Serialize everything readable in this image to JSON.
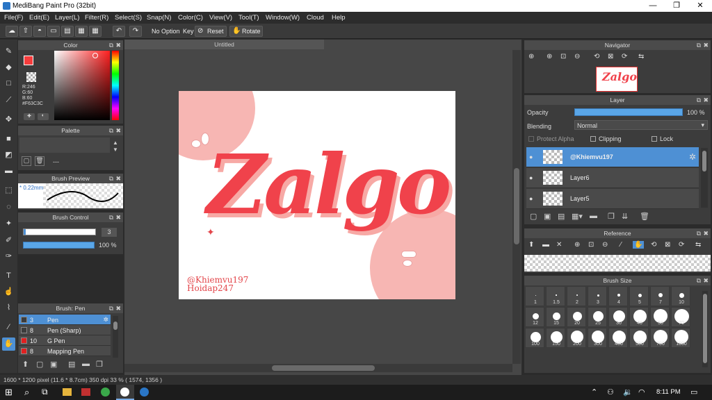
{
  "window": {
    "title": "MediBang Paint Pro (32bit)",
    "minimize": "—",
    "maximize": "❐",
    "close": "✕"
  },
  "menu": [
    "File(F)",
    "Edit(E)",
    "Layer(L)",
    "Filter(R)",
    "Select(S)",
    "Snap(N)",
    "Color(C)",
    "View(V)",
    "Tool(T)",
    "Window(W)",
    "Cloud",
    "Help"
  ],
  "toolbar": {
    "no_option": "No Option",
    "key": "Key",
    "reset": "Reset",
    "rotate": "Rotate"
  },
  "color_panel": {
    "title": "Color",
    "r": "R:246",
    "g": "G:60",
    "b": "B:60",
    "hex": "#F63C3C",
    "primary": "#f63c3c"
  },
  "palette_panel": {
    "title": "Palette",
    "dash": "---"
  },
  "brush_preview": {
    "title": "Brush Preview",
    "size": "* 0.22mm"
  },
  "brush_control": {
    "title": "Brush Control",
    "size": "3",
    "opacity": "100 %"
  },
  "brush_list": {
    "title": "Brush: Pen",
    "items": [
      {
        "size": "3",
        "name": "Pen",
        "color": "#3c3c3c",
        "selected": true
      },
      {
        "size": "8",
        "name": "Pen (Sharp)",
        "color": "#3c3c3c",
        "selected": false
      },
      {
        "size": "10",
        "name": "G Pen",
        "color": "#e02020",
        "selected": false
      },
      {
        "size": "8",
        "name": "Mapping Pen",
        "color": "#e02020",
        "selected": false
      }
    ]
  },
  "document": {
    "tab": "Untitled",
    "lettering": "Zalgo",
    "credit1": "@Khiemvu197",
    "credit2": "Hoidap247"
  },
  "navigator": {
    "title": "Navigator"
  },
  "layer_panel": {
    "title": "Layer",
    "opacity_label": "Opacity",
    "opacity_value": "100 %",
    "blending_label": "Blending",
    "blending_value": "Normal",
    "protect_alpha": "Protect Alpha",
    "clipping": "Clipping",
    "lock": "Lock",
    "layers": [
      "@Khiemvu197",
      "Layer6",
      "Layer5"
    ]
  },
  "reference": {
    "title": "Reference"
  },
  "brush_size": {
    "title": "Brush Size",
    "sizes": [
      "1",
      "1.5",
      "2",
      "3",
      "4",
      "5",
      "7",
      "10",
      "12",
      "15",
      "20",
      "25",
      "30",
      "40",
      "50",
      "70",
      "100",
      "150",
      "200",
      "300",
      "400",
      "500",
      "700",
      "1000"
    ]
  },
  "status": {
    "text": "1600 * 1200 pixel   (11.6 * 8.7cm)   350 dpi   33 %   ( 1574, 1356 )"
  },
  "taskbar": {
    "time": "8:11 PM"
  }
}
